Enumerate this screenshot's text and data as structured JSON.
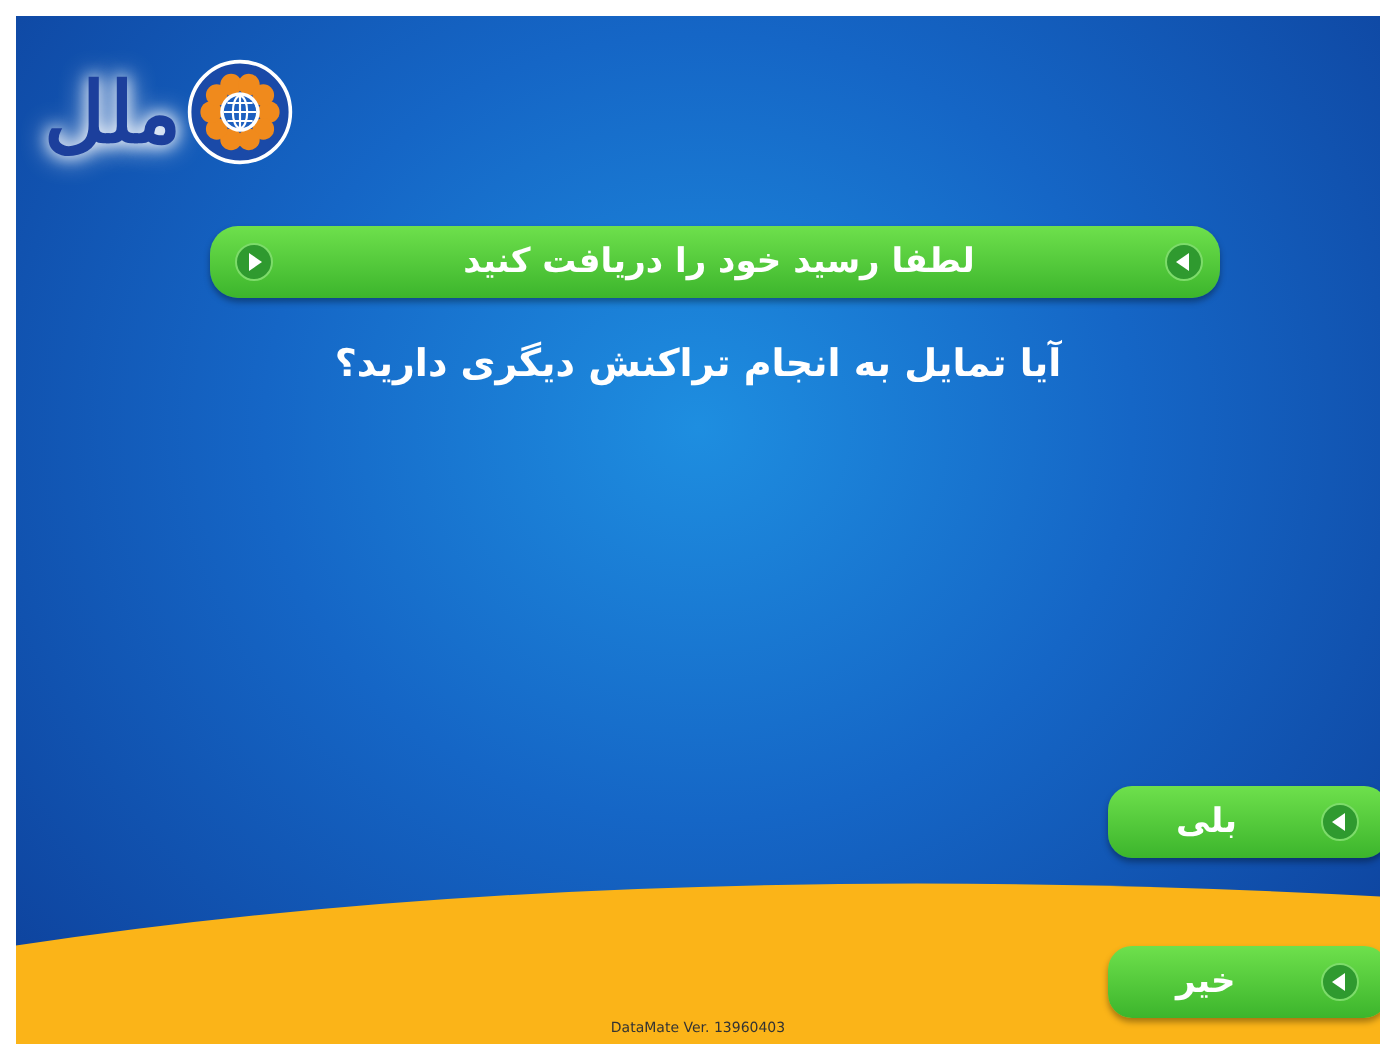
{
  "logo": {
    "text": "ملل"
  },
  "banner": {
    "text": "لطفا رسید خود را دریافت کنید"
  },
  "question": "آیا تمایل به انجام تراکنش دیگری دارید؟",
  "buttons": [
    {
      "label": "بلی"
    },
    {
      "label": "خیر"
    }
  ],
  "version": "DataMate Ver. 13960403"
}
